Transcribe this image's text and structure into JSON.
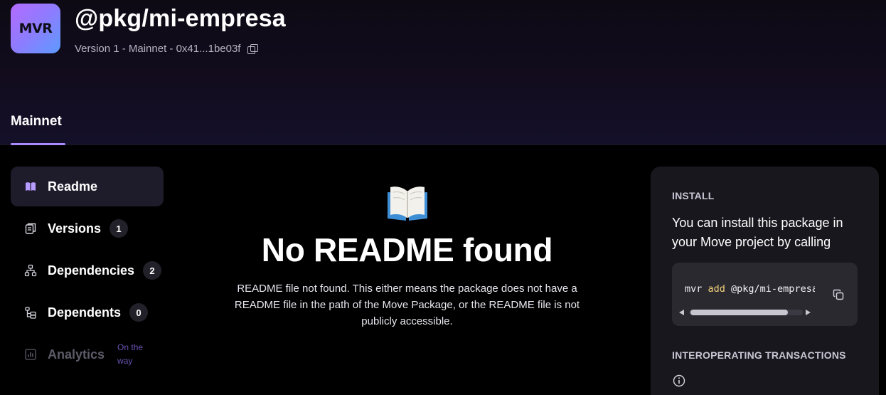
{
  "header": {
    "logo_text": "MVR",
    "package_name": "@pkg/mi-empresa",
    "meta": "Version 1 - Mainnet - 0x41...1be03f",
    "network_tab": "Mainnet"
  },
  "sidebar": {
    "items": [
      {
        "label": "Readme",
        "icon": "book-icon",
        "active": true
      },
      {
        "label": "Versions",
        "icon": "versions-icon",
        "badge": "1"
      },
      {
        "label": "Dependencies",
        "icon": "tree-icon",
        "badge": "2"
      },
      {
        "label": "Dependents",
        "icon": "list-icon",
        "badge": "0"
      },
      {
        "label": "Analytics",
        "icon": "chart-icon",
        "soon": "On the way",
        "disabled": true
      }
    ]
  },
  "main": {
    "emoji": "📖",
    "title": "No README found",
    "description": "README file not found. This either means the package does not have a README file in the path of the Move Package, or the README file is not publicly accessible."
  },
  "install": {
    "heading": "INSTALL",
    "text": "You can install this package in your Move project by calling",
    "command_prefix": "mvr ",
    "command_keyword": "add",
    "command_arg": " @pkg/mi-empresa"
  },
  "interop": {
    "heading": "INTEROPERATING TRANSACTIONS"
  },
  "colors": {
    "accent": "#a98bff",
    "panel_bg": "#18171d",
    "active_nav_bg": "#1e1b2a",
    "code_keyword": "#f2d27a"
  }
}
